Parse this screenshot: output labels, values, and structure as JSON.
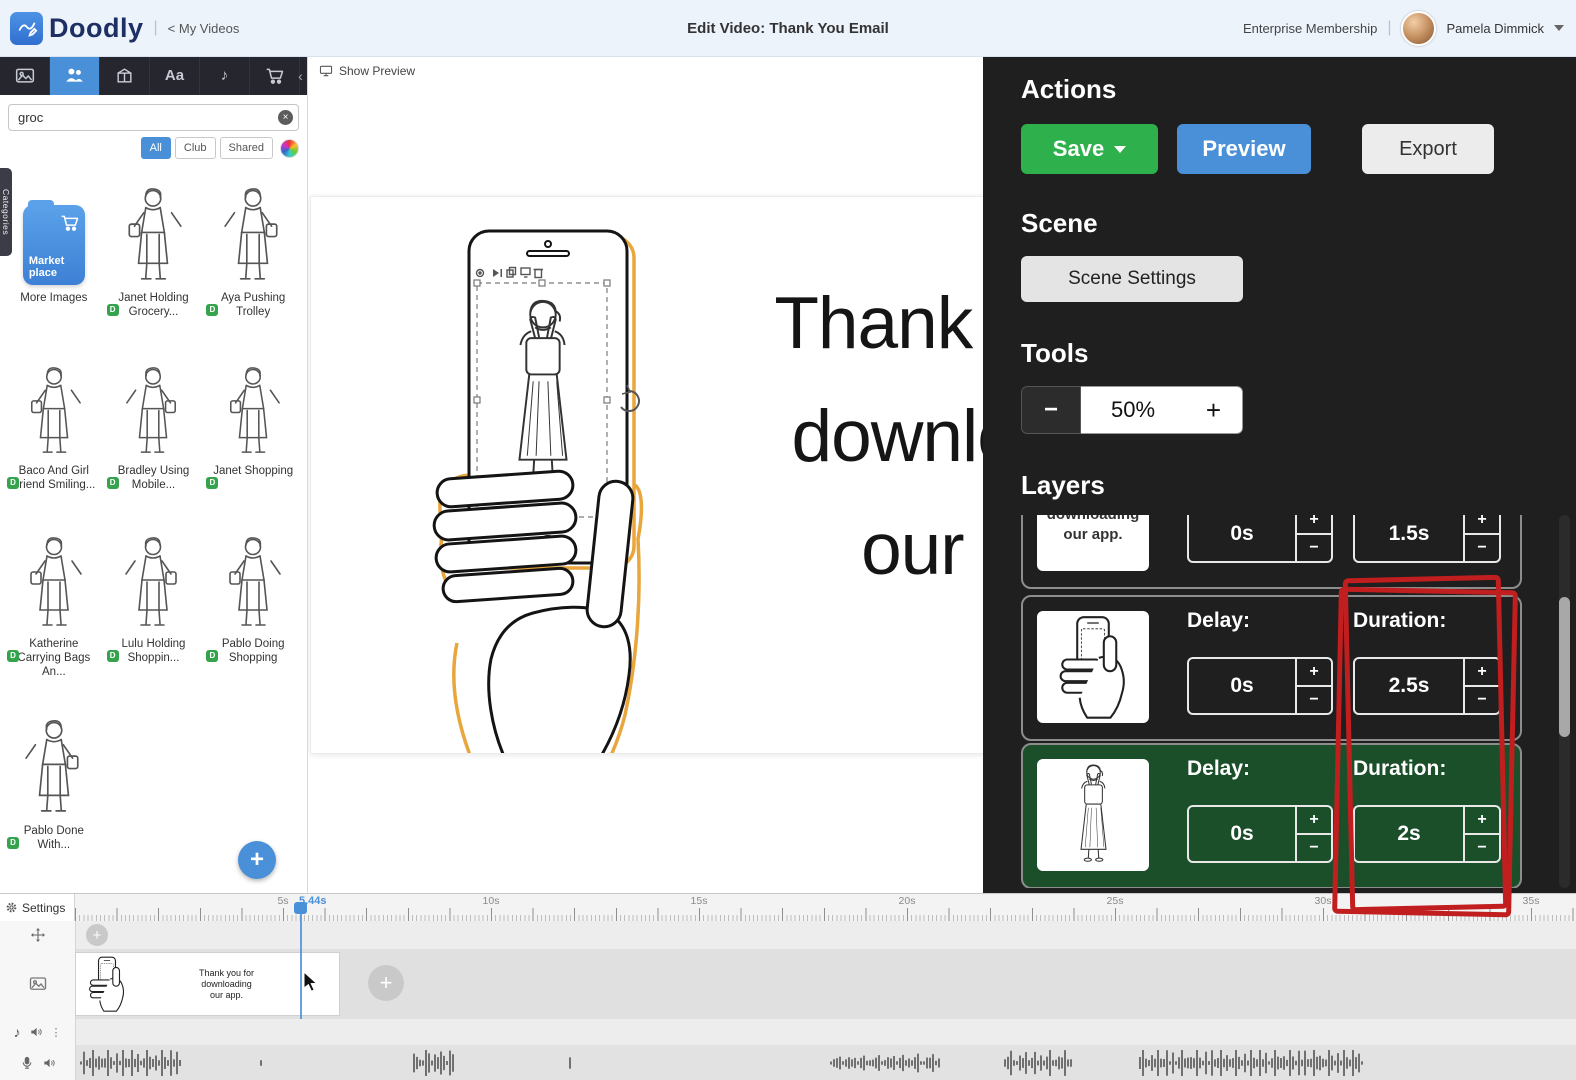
{
  "header": {
    "logo": "Doodly",
    "back_link": "< My Videos",
    "title": "Edit Video: Thank You Email",
    "membership": "Enterprise Membership",
    "user_name": "Pamela Dimmick"
  },
  "sidebar": {
    "categories_tab": "Categories",
    "search_value": "groc",
    "filters": {
      "all": "All",
      "club": "Club",
      "shared": "Shared"
    },
    "marketplace": {
      "line1": "Market",
      "line2": "place",
      "label": "More Images"
    },
    "characters": [
      {
        "label": "Janet Holding Grocery..."
      },
      {
        "label": "Aya Pushing Trolley"
      },
      {
        "label": "Baco And Girl Friend Smiling..."
      },
      {
        "label": "Bradley Using Mobile..."
      },
      {
        "label": "Janet Shopping"
      },
      {
        "label": "Katherine Carrying Bags An..."
      },
      {
        "label": "Lulu Holding Shoppin..."
      },
      {
        "label": "Pablo Doing Shopping"
      },
      {
        "label": "Pablo Done With..."
      }
    ],
    "add_label": "+"
  },
  "canvas": {
    "show_preview": "Show Preview",
    "text_line1": "Thank you for",
    "text_line2": "downloading",
    "text_line3": "our app."
  },
  "panel": {
    "actions_heading": "Actions",
    "save_label": "Save",
    "preview_label": "Preview",
    "export_label": "Export",
    "scene_heading": "Scene",
    "scene_settings_label": "Scene Settings",
    "tools_heading": "Tools",
    "zoom_minus": "−",
    "zoom_value": "50%",
    "zoom_plus": "+",
    "layers_heading": "Layers",
    "stepper_plus": "+",
    "stepper_minus": "−",
    "layer_text": {
      "thumb_line1": "downloading",
      "thumb_line2": "our app.",
      "delay_value": "0s",
      "duration_value": "1.5s"
    },
    "layer_phone": {
      "delay_label": "Delay:",
      "delay_value": "0s",
      "duration_label": "Duration:",
      "duration_value": "2.5s"
    },
    "layer_character": {
      "delay_label": "Delay:",
      "delay_value": "0s",
      "duration_label": "Duration:",
      "duration_value": "2s"
    }
  },
  "timeline": {
    "settings_label": "Settings",
    "playhead_time": "5.44s",
    "ruler_labels": [
      "5s",
      "10s",
      "15s",
      "20s",
      "25s",
      "30s",
      "35s"
    ],
    "scene_thumb": {
      "line1": "Thank you for",
      "line2": "downloading",
      "line3": "our app."
    },
    "add_label": "+"
  },
  "colors": {
    "accent_blue": "#4a90d9",
    "save_green": "#2eb14d",
    "selected_layer_green": "#1b4f2a",
    "annotation_red": "#c11f1f"
  }
}
